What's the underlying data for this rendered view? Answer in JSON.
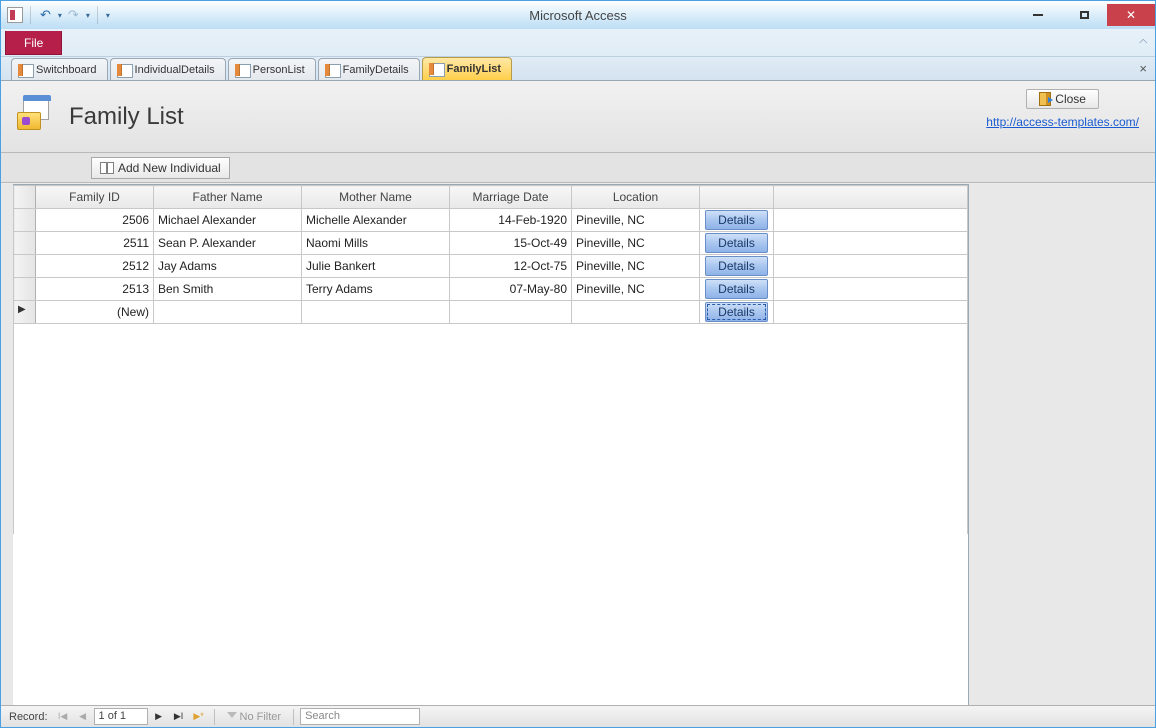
{
  "window": {
    "title": "Microsoft Access"
  },
  "ribbon": {
    "file": "File"
  },
  "tabs": [
    {
      "label": "Switchboard",
      "active": false
    },
    {
      "label": "IndividualDetails",
      "active": false
    },
    {
      "label": "PersonList",
      "active": false
    },
    {
      "label": "FamilyDetails",
      "active": false
    },
    {
      "label": "FamilyList",
      "active": true
    }
  ],
  "form": {
    "title": "Family List",
    "close": "Close",
    "template_link": "http://access-templates.com/",
    "add_button": "Add New Individual"
  },
  "columns": {
    "family_id": "Family ID",
    "father": "Father Name",
    "mother": "Mother Name",
    "marriage": "Marriage Date",
    "location": "Location"
  },
  "rows": [
    {
      "id": "2506",
      "father": "Michael Alexander",
      "mother": "Michelle Alexander",
      "date": "14-Feb-1920",
      "loc": "Pineville, NC"
    },
    {
      "id": "2511",
      "father": "Sean P. Alexander",
      "mother": "Naomi Mills",
      "date": "15-Oct-49",
      "loc": "Pineville, NC"
    },
    {
      "id": "2512",
      "father": "Jay Adams",
      "mother": "Julie Bankert",
      "date": "12-Oct-75",
      "loc": "Pineville, NC"
    },
    {
      "id": "2513",
      "father": "Ben Smith",
      "mother": "Terry Adams",
      "date": "07-May-80",
      "loc": "Pineville, NC"
    }
  ],
  "new_row_label": "(New)",
  "details_label": "Details",
  "recordnav": {
    "label": "Record:",
    "position": "1 of 1",
    "nofilter": "No Filter",
    "search": "Search"
  }
}
